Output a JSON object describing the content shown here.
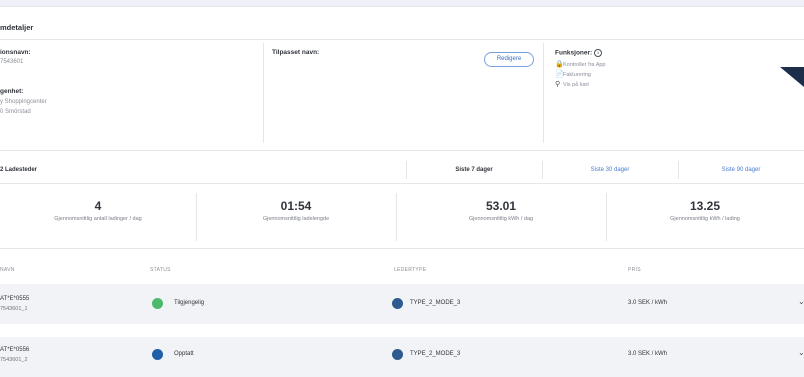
{
  "section": {
    "title": "mdetaljer"
  },
  "details": {
    "name_label": "ionsnavn:",
    "name_value": "7543601",
    "unit_label": "genhet:",
    "unit_line1": "y Shoppingcenter",
    "unit_line2": "0 Smörstad",
    "custom_name_label": "Tilpasset navn:",
    "edit_button": "Redigere",
    "functions_label": "Funksjoner:",
    "functions": [
      {
        "icon": "lock-icon",
        "text": "Kontroller fra App"
      },
      {
        "icon": "document-icon",
        "text": "Fakturering"
      },
      {
        "icon": "location-pin-icon",
        "text": "Vis på kart"
      }
    ]
  },
  "tabs": {
    "left_label": "2 Ladesteder",
    "items": [
      {
        "label": "Siste 7 dager",
        "active": true
      },
      {
        "label": "Siste 30 dager",
        "active": false
      },
      {
        "label": "Siste 90 dager",
        "active": false
      }
    ]
  },
  "stats": [
    {
      "value": "4",
      "caption": "Gjennomsnittlig antall ladinger / dag"
    },
    {
      "value": "01:54",
      "caption": "Gjennomsnittlig ladelengde"
    },
    {
      "value": "53.01",
      "caption": "Gjennomsnittlig kWh / dag"
    },
    {
      "value": "13.25",
      "caption": "Gjennomsnittlig kWh / lading"
    }
  ],
  "table": {
    "headers": {
      "name": "NAVN",
      "status": "STATUS",
      "connector": "LEDERTYPE",
      "price": "PRIS"
    },
    "rows": [
      {
        "name": "AT*E*0555",
        "sub": "7543601_1",
        "status": "Tilgjengelig",
        "status_color": "#4cb96b",
        "connector": "TYPE_2_MODE_3",
        "price": "3.0 SEK / kWh"
      },
      {
        "name": "AT*E*0556",
        "sub": "7543601_2",
        "status": "Opptatt",
        "status_color": "#1f5fa8",
        "connector": "TYPE_2_MODE_3",
        "price": "3.0 SEK / kWh"
      }
    ]
  },
  "colors": {
    "accent": "#4a7bd0",
    "available": "#4cb96b",
    "occupied": "#1f5fa8"
  }
}
